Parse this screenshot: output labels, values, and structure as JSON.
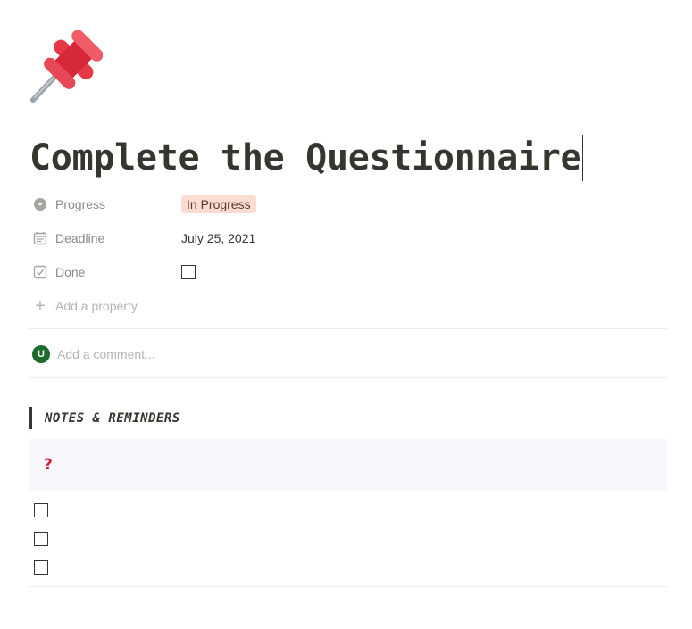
{
  "page": {
    "icon": "pushpin-icon",
    "title": "Complete the Questionnaire"
  },
  "properties": [
    {
      "name": "Progress",
      "icon": "status-circle-icon",
      "value": "In Progress",
      "type": "select",
      "color": "#fbdcd3"
    },
    {
      "name": "Deadline",
      "icon": "calendar-icon",
      "value": "July 25, 2021",
      "type": "date"
    },
    {
      "name": "Done",
      "icon": "checkbox-property-icon",
      "checked": false,
      "type": "checkbox"
    }
  ],
  "add_property_label": "Add a property",
  "comment": {
    "avatar_initial": "U",
    "avatar_color": "#1d6b2e",
    "placeholder": "Add a comment..."
  },
  "section": {
    "heading": "NOTES & REMINDERS"
  },
  "callout": {
    "icon": "question-mark-icon",
    "glyph": "?",
    "icon_color": "#d0233c"
  },
  "todos": [
    {
      "checked": false,
      "text": ""
    },
    {
      "checked": false,
      "text": ""
    },
    {
      "checked": false,
      "text": ""
    }
  ]
}
